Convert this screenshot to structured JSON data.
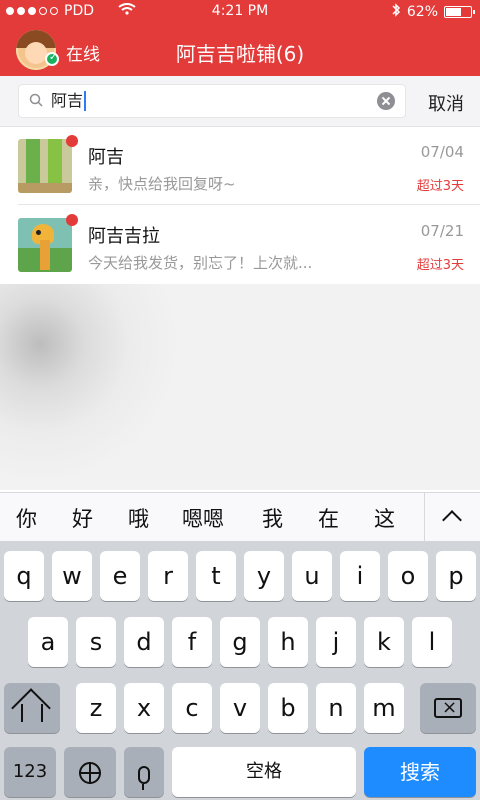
{
  "status_bar": {
    "carrier": "PDD",
    "time": "4:21 PM",
    "battery": "62%",
    "battery_fraction": 0.62
  },
  "header": {
    "status": "在线",
    "title": "阿吉吉啦铺(6)"
  },
  "search": {
    "query": "阿吉",
    "cancel_label": "取消"
  },
  "results": [
    {
      "name": "阿吉",
      "preview": "亲，快点给我回复呀~",
      "date": "07/04",
      "flag": "超过3天"
    },
    {
      "name": "阿吉吉拉",
      "preview": "今天给我发货，别忘了！上次就...",
      "date": "07/21",
      "flag": "超过3天"
    }
  ],
  "suggestions": [
    "你",
    "好",
    "哦",
    "嗯嗯",
    "我",
    "在",
    "这"
  ],
  "keyboard": {
    "row1": [
      "q",
      "w",
      "e",
      "r",
      "t",
      "y",
      "u",
      "i",
      "o",
      "p"
    ],
    "row2": [
      "a",
      "s",
      "d",
      "f",
      "g",
      "h",
      "j",
      "k",
      "l"
    ],
    "row3": [
      "z",
      "x",
      "c",
      "v",
      "b",
      "n",
      "m"
    ],
    "numbers_label": "123",
    "space_label": "空格",
    "search_label": "搜索"
  },
  "colors": {
    "accent": "#e33b3a",
    "blue": "#1e8cff"
  }
}
